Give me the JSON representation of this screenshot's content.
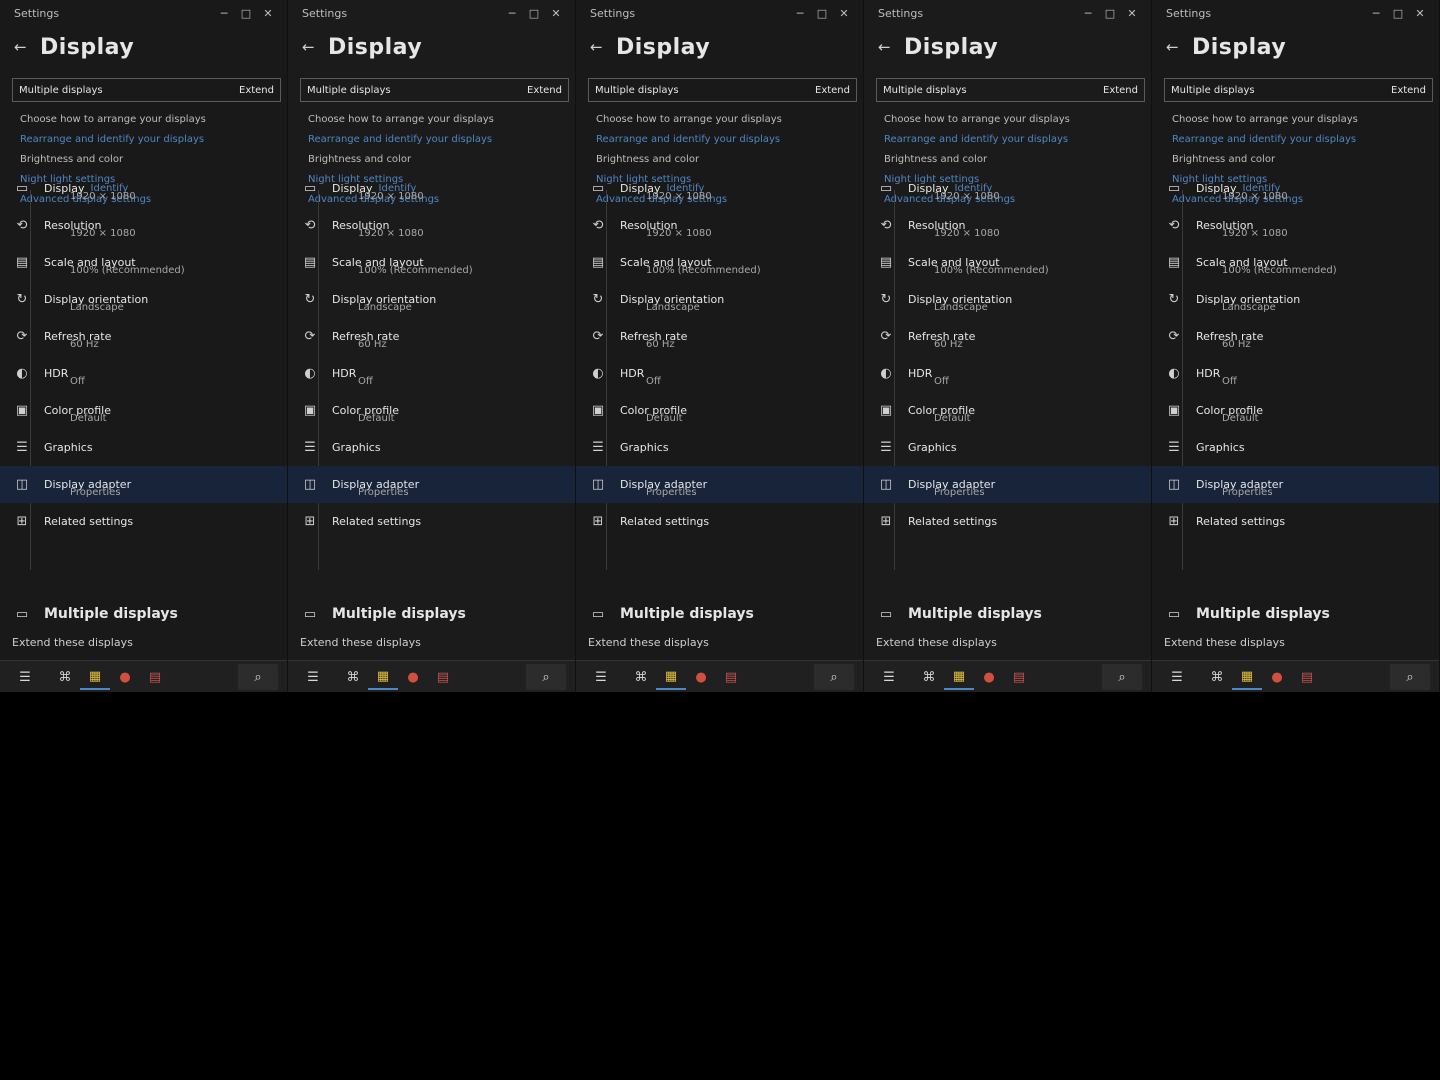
{
  "window": {
    "title": "Settings",
    "minimize_glyph": "─",
    "maximize_glyph": "□",
    "close_glyph": "✕"
  },
  "header": {
    "back_glyph": "←",
    "title": "Display"
  },
  "quick": {
    "label": "Multiple displays",
    "value": "Extend"
  },
  "links": {
    "first_text": "Choose how to arrange your displays",
    "first_link": "Rearrange and identify your displays",
    "second_text": "Brightness and color",
    "second_link": "Night light settings",
    "third_link": "Advanced display settings"
  },
  "rows": [
    {
      "icon": "▭",
      "label": "Display",
      "sub": "1920 × 1080",
      "link": "Identify"
    },
    {
      "icon": "⟲",
      "label": "Resolution",
      "sub": "1920 × 1080",
      "link": ""
    },
    {
      "icon": "▤",
      "label": "Scale and layout",
      "sub": "100% (Recommended)",
      "link": ""
    },
    {
      "icon": "↻",
      "label": "Display orientation",
      "sub": "Landscape",
      "link": ""
    },
    {
      "icon": "⟳",
      "label": "Refresh rate",
      "sub": "60 Hz",
      "link": ""
    },
    {
      "icon": "◐",
      "label": "HDR",
      "sub": "Off",
      "link": ""
    },
    {
      "icon": "▣",
      "label": "Color profile",
      "sub": "Default",
      "link": ""
    },
    {
      "icon": "☰",
      "label": "Graphics",
      "sub": "",
      "link": ""
    },
    {
      "icon": "◫",
      "label": "Display adapter",
      "sub": "Properties",
      "link": ""
    },
    {
      "icon": "⊞",
      "label": "Related settings",
      "sub": "",
      "link": ""
    }
  ],
  "selected_index": 8,
  "multi": {
    "icon": "▭",
    "label": "Multiple displays"
  },
  "bottom": {
    "text": "Extend these displays"
  },
  "taskbar": {
    "start_glyph": "☰",
    "apps": [
      "⌘",
      "▦",
      "●",
      "▤"
    ],
    "app_colors": [
      "#cfcfcf",
      "#e0c040",
      "#d05040",
      "#c05050"
    ],
    "search_glyph": "⌕"
  }
}
